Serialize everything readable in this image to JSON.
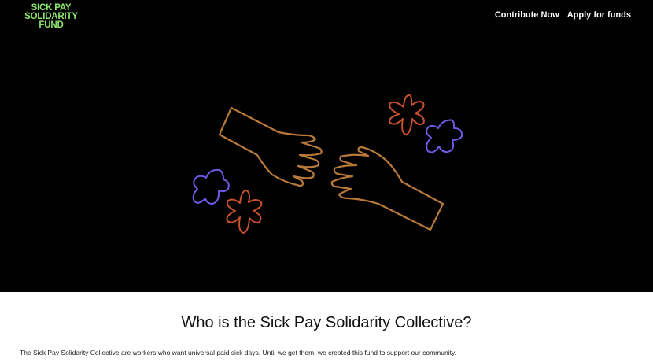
{
  "header": {
    "logo_lines": [
      "SICK PAY",
      "SOLIDARITY",
      "FUND"
    ],
    "nav": [
      {
        "label": "Contribute Now"
      },
      {
        "label": "Apply for funds"
      }
    ]
  },
  "colors": {
    "logo": "#8be66c",
    "hero_bg": "#000000",
    "hand_stroke": "#b8793a",
    "flower_red": "#c8502a",
    "flower_purple": "#6f5ae6"
  },
  "illustration": {
    "icons": [
      "left-hand-icon",
      "right-hand-icon",
      "red-flower-icon",
      "purple-flower-icon"
    ]
  },
  "about": {
    "heading": "Who is the Sick Pay Solidarity Collective?",
    "body": "The Sick Pay Solidarity Collective are workers who want universal paid sick days. Until we get them, we created this fund to support our community."
  }
}
